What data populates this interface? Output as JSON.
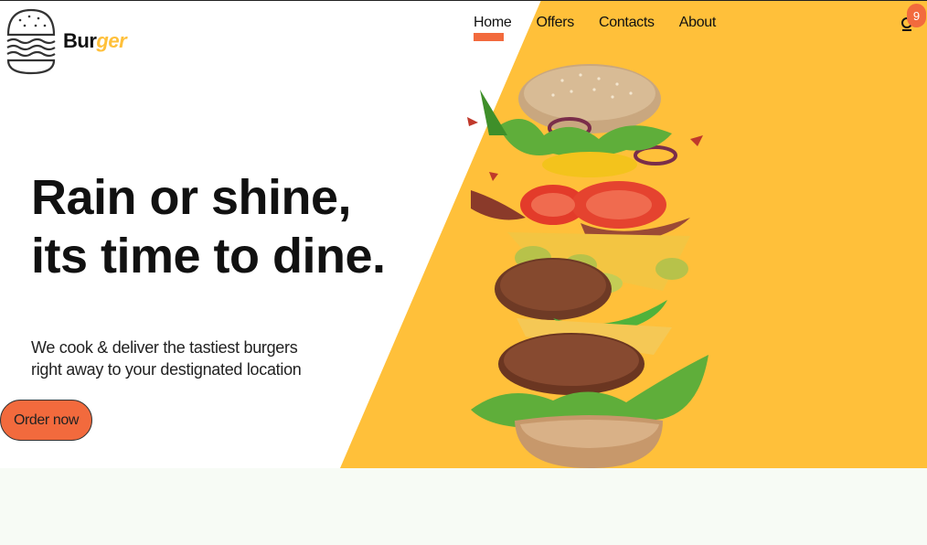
{
  "brand": {
    "name_part1": "Bur",
    "name_part2": "ger",
    "accent_color": "#ffc03a",
    "logo_icon": "burger-logo-icon"
  },
  "nav": {
    "items": [
      {
        "label": "Home",
        "active": true
      },
      {
        "label": "Offers",
        "active": false
      },
      {
        "label": "Contacts",
        "active": false
      },
      {
        "label": "About",
        "active": false
      }
    ],
    "active_indicator_color": "#f26a3d"
  },
  "cart": {
    "icon": "cart-user-icon",
    "count": "9",
    "badge_color": "#f26a3d"
  },
  "hero": {
    "headline_line1": "Rain or shine,",
    "headline_line2": "its time to dine.",
    "subtext_line1": "We cook & deliver the tastiest burgers",
    "subtext_line2": "right away to your destignated location",
    "cta_label": "Order now",
    "cta_color": "#f26a3d",
    "panel_color": "#ffc03a",
    "image": "stacked-burger-image"
  },
  "footer": {
    "background": "#f7fbf5"
  }
}
